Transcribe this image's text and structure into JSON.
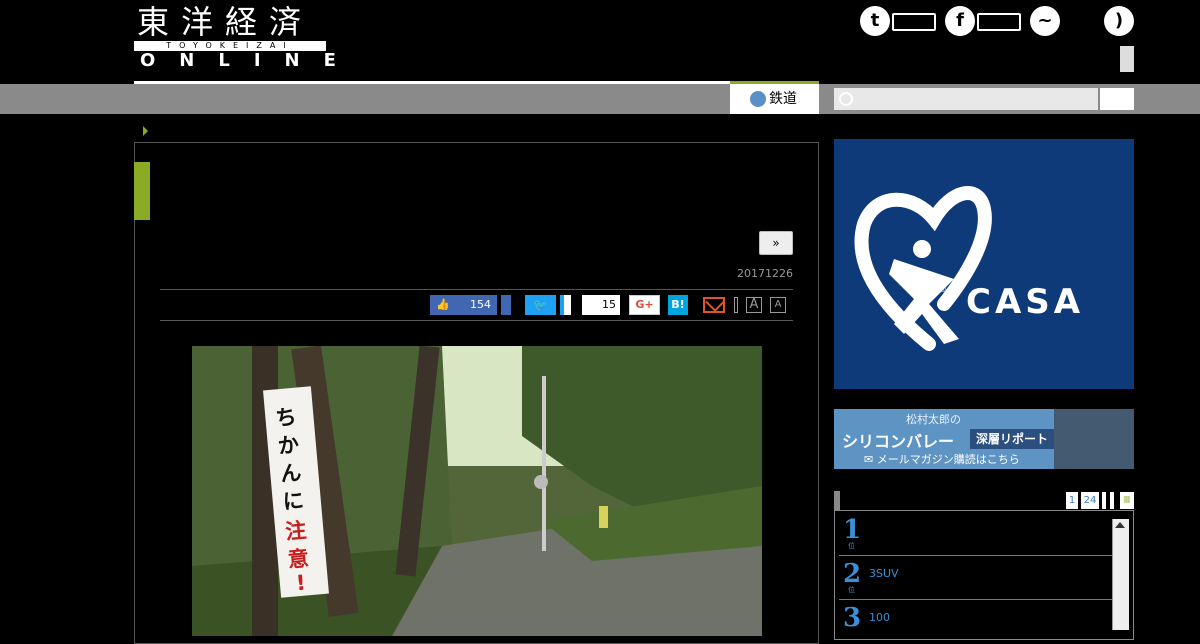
{
  "header": {
    "logo_jp": "東洋経済",
    "logo_romaji": "TOYOKEIZAI",
    "logo_en": "ONLINE"
  },
  "nav": {
    "tab_label": "鉄道",
    "search_placeholder": ""
  },
  "article": {
    "more_label": "»",
    "date": "20171226",
    "like_count": "154",
    "share_count": "15",
    "gplus_label": "G+",
    "hatena_label": "B!",
    "font_large": "A",
    "font_small": "A",
    "photo_sign_line1": "ちかんに",
    "photo_sign_line2": "注意!"
  },
  "sidebar": {
    "ad_brand": "CASA",
    "banner": {
      "line1": "松村太郎の",
      "line2": "シリコンバレー",
      "tag": "深層リポート",
      "line3": "メールマガジン購読はこちら"
    },
    "ranking": {
      "tabs": [
        "1",
        "24"
      ],
      "items": [
        {
          "rank": "1",
          "title": ""
        },
        {
          "rank": "2",
          "title": "3SUV"
        },
        {
          "rank": "3",
          "title": "100"
        }
      ]
    }
  },
  "colors": {
    "accent_green": "#8aab23",
    "facebook": "#4267b2",
    "twitter": "#1da1f2",
    "casa_blue": "#0e3a7a"
  }
}
